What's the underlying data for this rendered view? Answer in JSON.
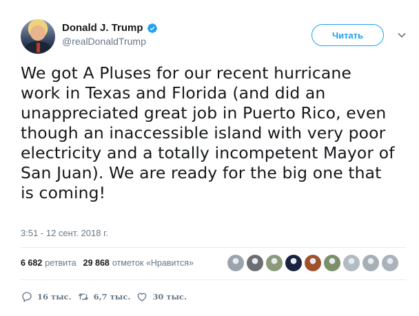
{
  "author": {
    "name": "Donald J. Trump",
    "handle": "@realDonaldTrump",
    "verified": true
  },
  "follow_button_label": "Читать",
  "tweet": {
    "text": "We got A Pluses for our recent hurricane\nwork in Texas and Florida (and did an\nunappreciated great job in Puerto Rico, even\nthough an inaccessible island with very poor\nelectricity and a totally incompetent Mayor of\nSan Juan). We are ready for the big one that\nis coming!",
    "timestamp": "3:51 - 12 сент. 2018 г."
  },
  "stats": {
    "retweets_count": "6 682",
    "retweets_label": "ретвита",
    "likes_count": "29 868",
    "likes_label": "отметок «Нравится»"
  },
  "liker_avatar_colors": [
    "#9aa4ad",
    "#6b6f73",
    "#8a9a7b",
    "#1a2440",
    "#a0522d",
    "#7a8f6a",
    "#b3bcc4",
    "#a7afb6",
    "#aab2ba"
  ],
  "actions": {
    "replies": "16 тыс.",
    "retweets": "6,7 тыс.",
    "likes": "30 тыс."
  },
  "colors": {
    "accent": "#1da1f2",
    "secondary_text": "#657786"
  },
  "icons": {
    "verified": "verified-badge-icon",
    "caret": "chevron-down-icon",
    "reply": "reply-icon",
    "retweet": "retweet-icon",
    "like": "heart-icon"
  }
}
